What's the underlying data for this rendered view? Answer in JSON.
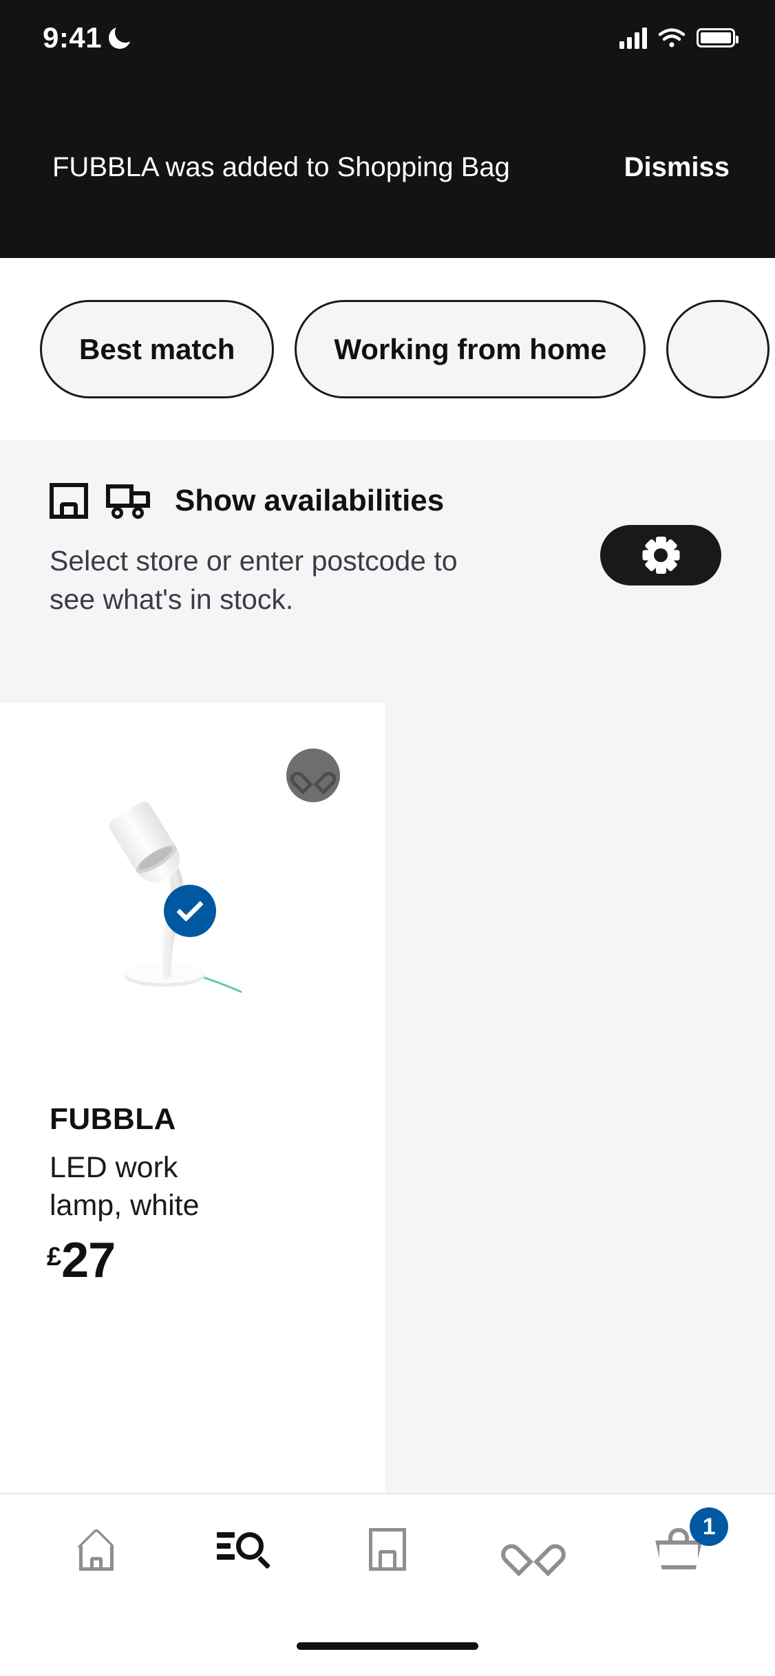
{
  "status_bar": {
    "time": "9:41",
    "moon_icon": "moon-icon",
    "signal_icon": "signal-bars-icon",
    "wifi_icon": "wifi-icon",
    "battery_icon": "battery-icon"
  },
  "toast": {
    "message": "FUBBLA was added to Shopping Bag",
    "dismiss_label": "Dismiss"
  },
  "filter_chips": [
    {
      "label": "Best match"
    },
    {
      "label": "Working from home"
    },
    {
      "label": ""
    }
  ],
  "availability": {
    "store_icon": "store-icon",
    "truck_icon": "delivery-truck-icon",
    "title": "Show availabilities",
    "description": "Select store or enter postcode to see what's in stock.",
    "settings_icon": "gear-icon"
  },
  "product": {
    "favourite_icon": "heart-icon",
    "image_alt": "white LED work lamp",
    "name": "FUBBLA",
    "description": "LED work lamp, white",
    "currency": "£",
    "price": "27",
    "add_state_icon": "check-icon"
  },
  "tab_bar": {
    "items": [
      {
        "name": "home",
        "icon": "home-icon",
        "active": false
      },
      {
        "name": "search",
        "icon": "search-icon",
        "active": true
      },
      {
        "name": "stores",
        "icon": "store-icon",
        "active": false
      },
      {
        "name": "favourites",
        "icon": "heart-icon",
        "active": false
      },
      {
        "name": "shopping-bag",
        "icon": "basket-icon",
        "active": false,
        "badge": "1"
      }
    ]
  },
  "colors": {
    "toast_bg": "#131316",
    "banner_bg": "#f5f4f6",
    "accent_blue": "#0058a3",
    "chip_bg": "#f5f4f6"
  }
}
